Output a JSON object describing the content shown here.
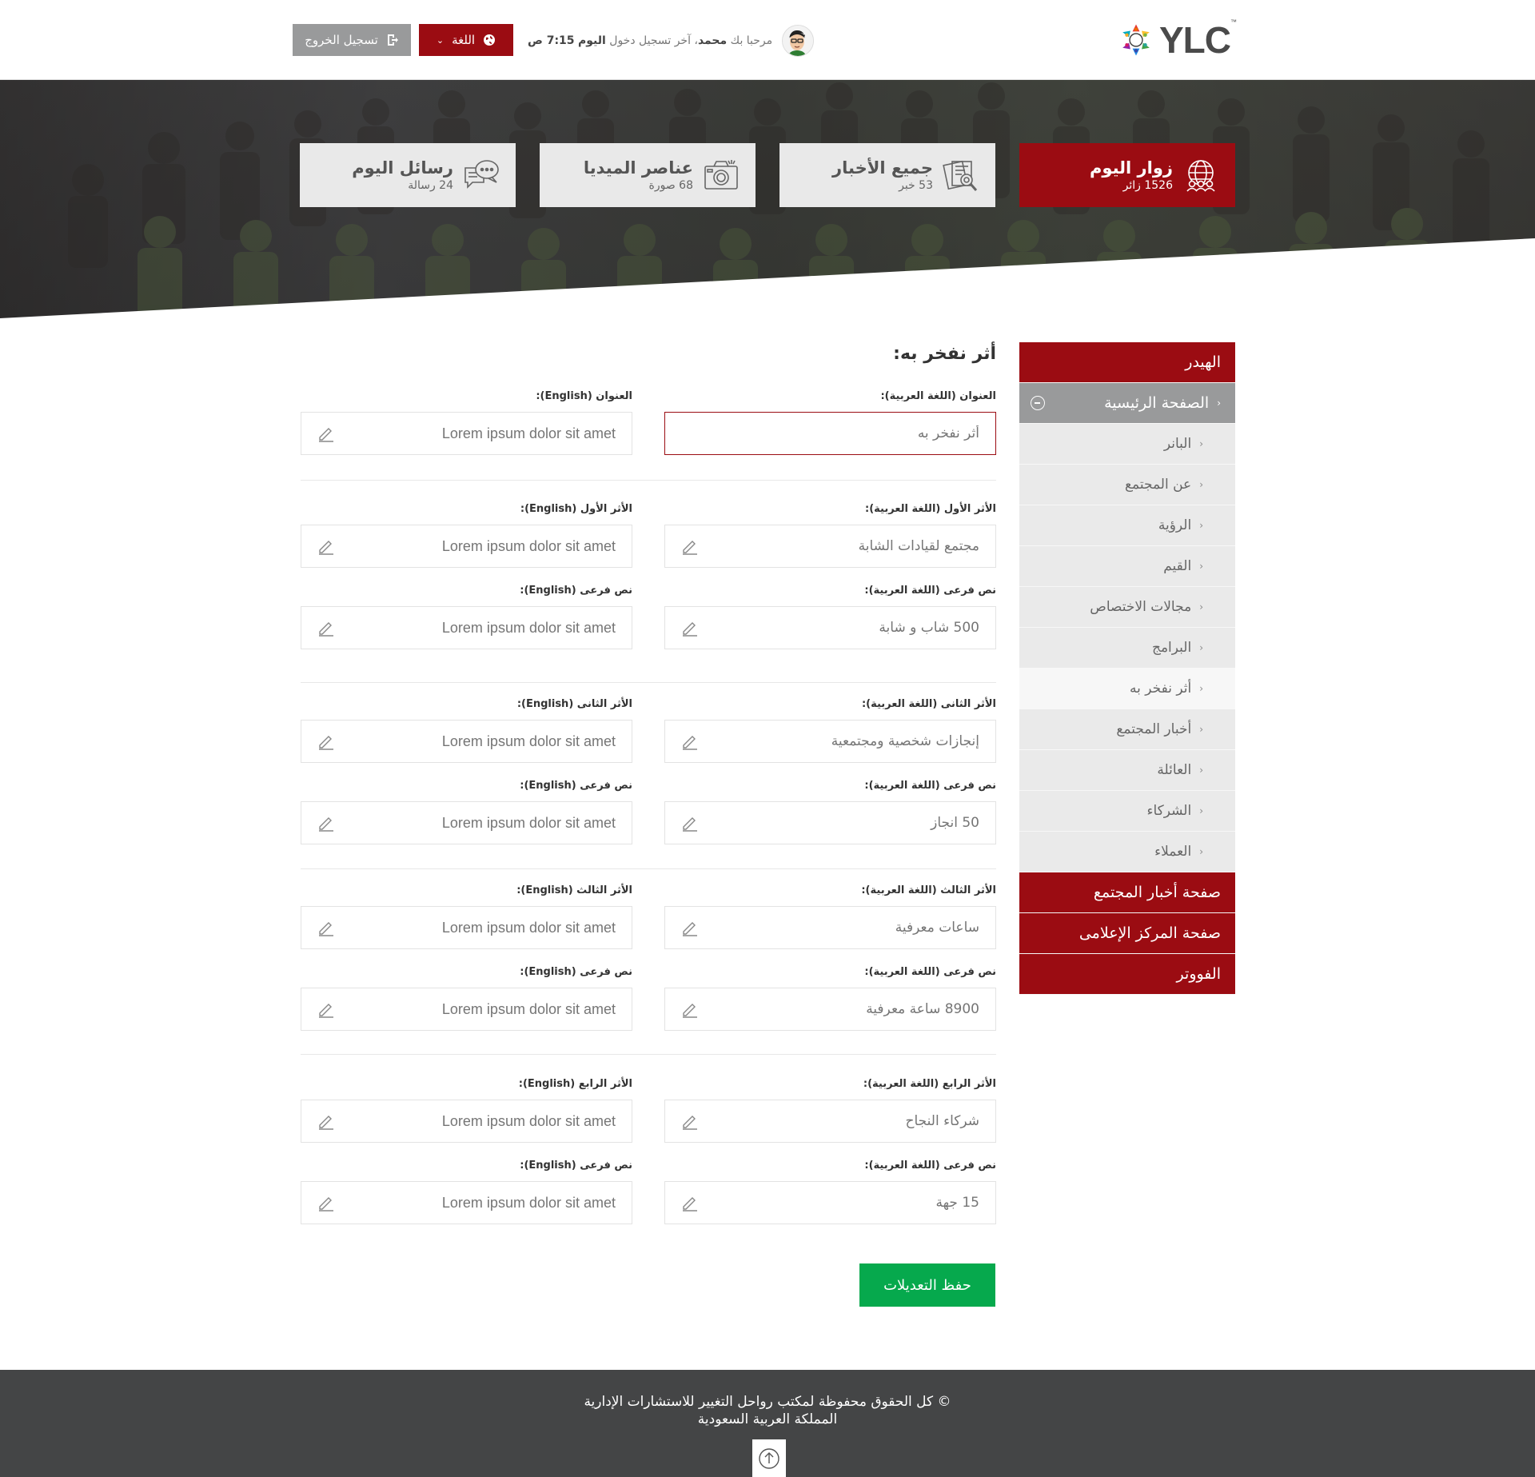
{
  "header": {
    "logo_text": "YLC",
    "logo_tm": "™",
    "greeting_prefix": "مرحبا بك",
    "user_name": "محمد",
    "last_login_prefix": "، آخر تسجيل دخول",
    "last_login_day": "اليوم",
    "last_login_time": "7:15 ص",
    "language_label": "اللغة",
    "logout_label": "تسجيل الخروج"
  },
  "stats": [
    {
      "title": "زوار اليوم",
      "sub": "1526 زائر",
      "icon": "globe-people-icon"
    },
    {
      "title": "جميع الأخبار",
      "sub": "53 خبر",
      "icon": "news-search-icon"
    },
    {
      "title": "عناصر الميديا",
      "sub": "68 صورة",
      "icon": "camera-icon"
    },
    {
      "title": "رسائل اليوم",
      "sub": "24 رسالة",
      "icon": "chat-bubbles-icon"
    }
  ],
  "sidebar": {
    "header": "الهيدر",
    "home": "الصفحة الرئيسية",
    "sub_items": [
      "البانر",
      "عن المجتمع",
      "الرؤية",
      "القيم",
      "مجالات الاختصاص",
      "البرامج",
      "أثر نفخر به",
      "أخبار المجتمع",
      "العائلة",
      "الشركاء",
      "العملاء"
    ],
    "news_page": "صفحة أخبار المجتمع",
    "media_page": "صفحة المركز الإعلامى",
    "footer": "الفووتر"
  },
  "form": {
    "title": "أثر نفخر به:",
    "title_ar_label": "العنوان (اللغة العربية):",
    "title_en_label": "العنوان (English):",
    "title_ar_value": "أثر نفخر به",
    "title_en_value": "Lorem ipsum dolor sit amet",
    "groups": [
      {
        "ar_label": "الأثر الأول (اللغة العربية):",
        "en_label": "الأثر الأول (English):",
        "ar_value": "مجتمع لقيادات الشابة",
        "en_value": "Lorem ipsum dolor sit amet",
        "sub_ar_label": "نص فرعى (اللغة العربية):",
        "sub_en_label": "نص فرعى (English):",
        "sub_ar_value": "500 شاب و شابة",
        "sub_en_value": "Lorem ipsum dolor sit amet"
      },
      {
        "ar_label": "الأثر الثانى (اللغة العربية):",
        "en_label": "الأثر الثانى (English):",
        "ar_value": "إنجازات شخصية ومجتمعية",
        "en_value": "Lorem ipsum dolor sit amet",
        "sub_ar_label": "نص فرعى (اللغة العربية):",
        "sub_en_label": "نص فرعى (English):",
        "sub_ar_value": "50 انجاز",
        "sub_en_value": "Lorem ipsum dolor sit amet"
      },
      {
        "ar_label": "الأثر الثالث (اللغة العربية):",
        "en_label": "الأثر الثالث (English):",
        "ar_value": "ساعات معرفية",
        "en_value": "Lorem ipsum dolor sit amet",
        "sub_ar_label": "نص فرعى (اللغة العربية):",
        "sub_en_label": "نص فرعى (English):",
        "sub_ar_value": "8900 ساعة معرفية",
        "sub_en_value": "Lorem ipsum dolor sit amet"
      },
      {
        "ar_label": "الأثر الرابع (اللغة العربية):",
        "en_label": "الأثر الرابع (English):",
        "ar_value": "شركاء النجاح",
        "en_value": "Lorem ipsum dolor sit amet",
        "sub_ar_label": "نص فرعى (اللغة العربية):",
        "sub_en_label": "نص فرعى (English):",
        "sub_ar_value": "15 جهة",
        "sub_en_value": "Lorem ipsum dolor sit amet"
      }
    ],
    "save_label": "حفظ التعديلات"
  },
  "footer": {
    "line1": "© كل الحقوق محفوظة لمكتب رواحل التغيير للاستشارات الإدارية",
    "line2": "المملكة العربية السعودية"
  },
  "colors": {
    "brand_red": "#9b0c12",
    "gray_button": "#999a9b",
    "save_green": "#06a94d",
    "footer_bg": "#444546"
  }
}
